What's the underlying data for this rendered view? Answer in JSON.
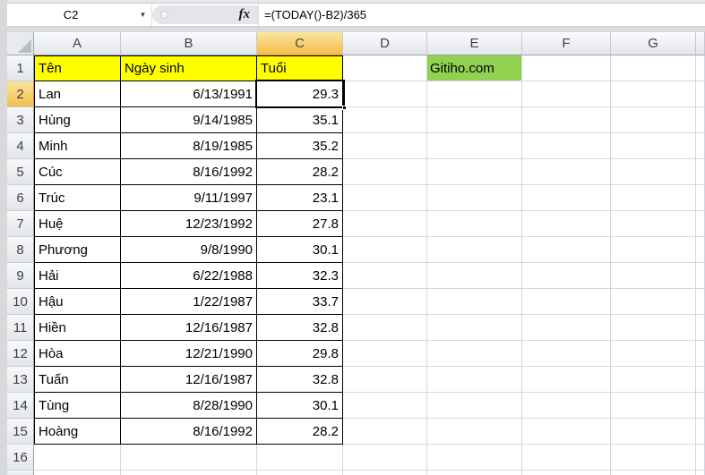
{
  "chrome": {
    "name_box_value": "C2",
    "fx_icon_label": "fx",
    "formula": "=(TODAY()-B2)/365"
  },
  "column_headers": [
    "A",
    "B",
    "C",
    "D",
    "E",
    "F",
    "G"
  ],
  "row_numbers": [
    "1",
    "2",
    "3",
    "4",
    "5",
    "6",
    "7",
    "8",
    "9",
    "10",
    "11",
    "12",
    "13",
    "14",
    "15",
    "16"
  ],
  "selection": {
    "active_cell": "C2",
    "highlighted_column": "C",
    "highlighted_row": "2"
  },
  "sheet": {
    "header_row": {
      "ten": "Tên",
      "ngay_sinh": "Ngày sinh",
      "tuoi": "Tuổi"
    },
    "brand_cell": "Gitiho.com",
    "rows": [
      {
        "name": "Lan",
        "birth": "6/13/1991",
        "age": "29.3"
      },
      {
        "name": "Hùng",
        "birth": "9/14/1985",
        "age": "35.1"
      },
      {
        "name": "Minh",
        "birth": "8/19/1985",
        "age": "35.2"
      },
      {
        "name": "Cúc",
        "birth": "8/16/1992",
        "age": "28.2"
      },
      {
        "name": "Trúc",
        "birth": "9/11/1997",
        "age": "23.1"
      },
      {
        "name": "Huệ",
        "birth": "12/23/1992",
        "age": "27.8"
      },
      {
        "name": "Phương",
        "birth": "9/8/1990",
        "age": "30.1"
      },
      {
        "name": "Hải",
        "birth": "6/22/1988",
        "age": "32.3"
      },
      {
        "name": "Hậu",
        "birth": "1/22/1987",
        "age": "33.7"
      },
      {
        "name": "Hiền",
        "birth": "12/16/1987",
        "age": "32.8"
      },
      {
        "name": "Hòa",
        "birth": "12/21/1990",
        "age": "29.8"
      },
      {
        "name": "Tuấn",
        "birth": "12/16/1987",
        "age": "32.8"
      },
      {
        "name": "Tùng",
        "birth": "8/28/1990",
        "age": "30.1"
      },
      {
        "name": "Hoàng",
        "birth": "8/16/1992",
        "age": "28.2"
      }
    ]
  },
  "colors": {
    "header_fill_yellow": "#FFFF00",
    "brand_fill_green": "#92D050",
    "selected_header_amber_top": "#FAE6A0",
    "selected_header_amber_bottom": "#F3BD4A",
    "grid_line": "#D0D7E5",
    "table_border": "#000000"
  }
}
